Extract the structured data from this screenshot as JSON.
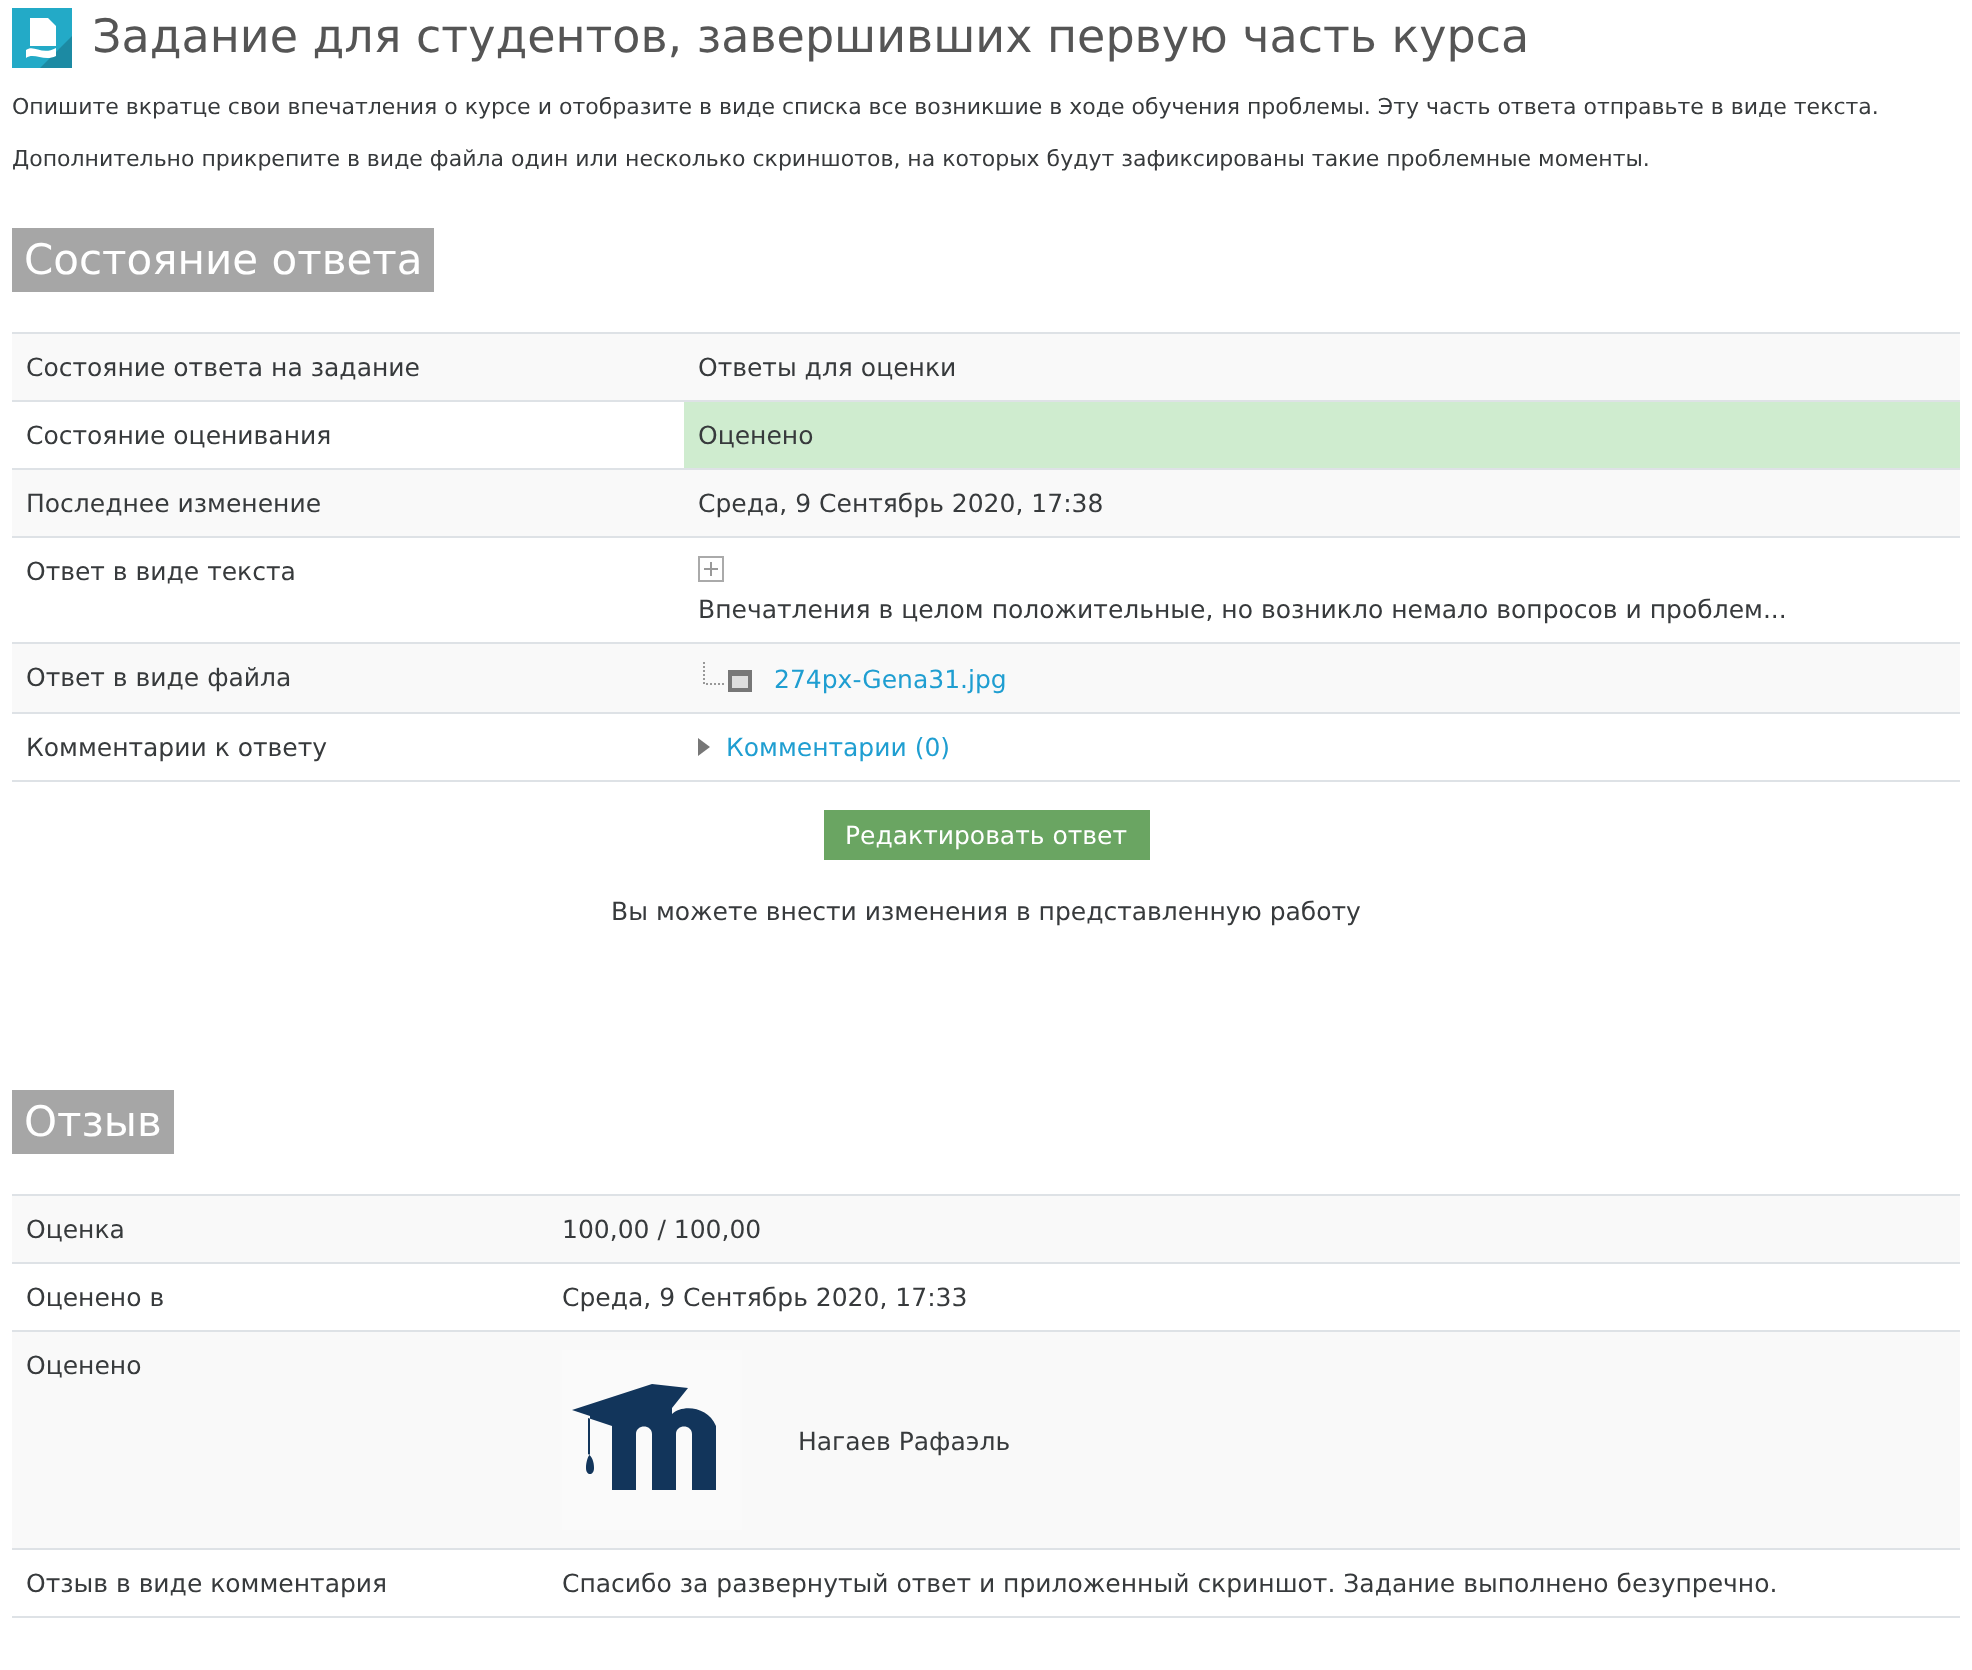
{
  "title": "Задание для студентов, завершивших первую часть курса",
  "intro": [
    "Опишите вкратце свои впечатления о курсе и отобразите в виде списка все возникшие в ходе обучения проблемы. Эту часть ответа отправьте в виде текста.",
    "Дополнительно прикрепите в виде файла один или несколько скриншотов, на которых будут зафиксированы такие проблемные моменты."
  ],
  "submission": {
    "heading": "Состояние ответа",
    "rows": [
      {
        "kind": "text",
        "label": "Состояние ответа на задание",
        "value": "Ответы для оценки"
      },
      {
        "kind": "status",
        "label": "Состояние оценивания",
        "value": "Оценено",
        "graded": true
      },
      {
        "kind": "text",
        "label": "Последнее изменение",
        "value": "Среда, 9 Сентябрь 2020, 17:38"
      },
      {
        "kind": "expandable",
        "label": "Ответ в виде текста",
        "value": "Впечатления в целом положительные, но возникло немало вопросов и проблем...",
        "expanded": false
      },
      {
        "kind": "file",
        "label": "Ответ в виде файла",
        "value": "274px-Gena31.jpg"
      },
      {
        "kind": "comments",
        "label": "Комментарии к ответу",
        "value": "Комментарии (0)",
        "expanded": false
      }
    ],
    "button": "Редактировать ответ",
    "note": "Вы можете внести изменения в представленную работу"
  },
  "feedback": {
    "heading": "Отзыв",
    "rows": [
      {
        "kind": "text",
        "label": "Оценка",
        "value": "100,00 / 100,00"
      },
      {
        "kind": "text",
        "label": "Оценено в",
        "value": "Среда, 9 Сентябрь 2020, 17:33"
      },
      {
        "kind": "user",
        "label": "Оценено",
        "value": "Нагаев Рафаэль"
      },
      {
        "kind": "text",
        "label": "Отзыв в виде комментария",
        "value": "Спасибо за развернутый ответ и приложенный скриншот. Задание выполнено безупречно."
      }
    ]
  }
}
